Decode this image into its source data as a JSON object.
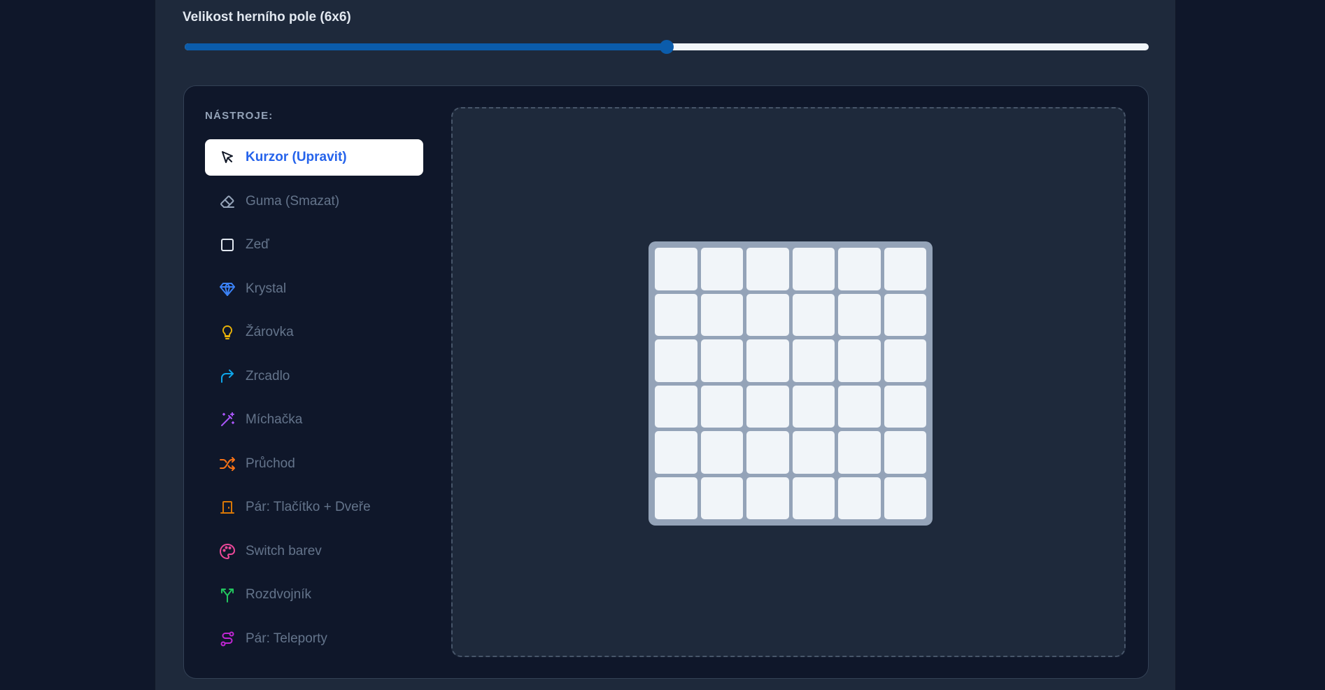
{
  "size": {
    "label": "Velikost herního pole (6x6)",
    "value": 6,
    "min": 2,
    "max": 10,
    "fraction": 0.5
  },
  "tools": {
    "heading": "NÁSTROJE:",
    "items": [
      {
        "label": "Kurzor (Upravit)",
        "icon": "cursor-icon",
        "color": "#111827",
        "active": true
      },
      {
        "label": "Guma (Smazat)",
        "icon": "eraser-icon",
        "color": "#94a3b8",
        "active": false
      },
      {
        "label": "Zeď",
        "icon": "wall-square-icon",
        "color": "#e2e8f0",
        "active": false
      },
      {
        "label": "Krystal",
        "icon": "crystal-gem-icon",
        "color": "#3b82f6",
        "active": false
      },
      {
        "label": "Žárovka",
        "icon": "lightbulb-icon",
        "color": "#eab308",
        "active": false
      },
      {
        "label": "Zrcadlo",
        "icon": "mirror-redirect-icon",
        "color": "#0ea5e9",
        "active": false
      },
      {
        "label": "Míchačka",
        "icon": "mixer-wand-icon",
        "color": "#a855f7",
        "active": false
      },
      {
        "label": "Průchod",
        "icon": "passage-shuffle-icon",
        "color": "#f97316",
        "active": false
      },
      {
        "label": "Pár: Tlačítko + Dveře",
        "icon": "door-icon",
        "color": "#d97706",
        "active": false
      },
      {
        "label": "Switch barev",
        "icon": "palette-icon",
        "color": "#ec4899",
        "active": false
      },
      {
        "label": "Rozdvojník",
        "icon": "splitter-icon",
        "color": "#22c55e",
        "active": false
      },
      {
        "label": "Pár: Teleporty",
        "icon": "teleport-icon",
        "color": "#c026d3",
        "active": false
      }
    ]
  },
  "board": {
    "rows": 6,
    "cols": 6,
    "cell_color": "#f1f5f9",
    "frame_color": "#94a3b8"
  },
  "colors": {
    "accent": "#0b5cab",
    "active_tool_text": "#2563eb",
    "background": "#0f172a",
    "panel": "#1e293b"
  }
}
